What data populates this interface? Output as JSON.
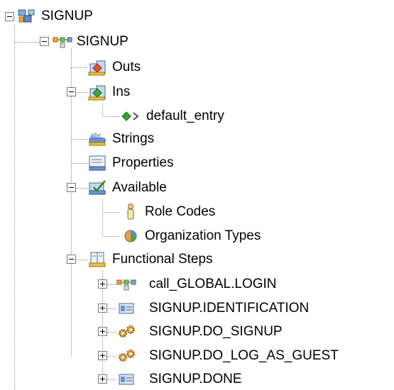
{
  "tree": {
    "root": {
      "label": "SIGNUP",
      "icon": "process-icon",
      "expanded": true
    },
    "process": {
      "label": "SIGNUP",
      "icon": "flow-icon",
      "expanded": true
    },
    "outs": {
      "label": "Outs",
      "icon": "outs-icon"
    },
    "ins": {
      "label": "Ins",
      "icon": "ins-icon",
      "expanded": true,
      "children": [
        {
          "label": "default_entry",
          "icon": "entry-icon"
        }
      ]
    },
    "strings": {
      "label": "Strings",
      "icon": "strings-icon"
    },
    "properties": {
      "label": "Properties",
      "icon": "properties-icon"
    },
    "available": {
      "label": "Available",
      "icon": "available-icon",
      "expanded": true,
      "children": [
        {
          "label": "Role Codes",
          "icon": "person-icon"
        },
        {
          "label": "Organization Types",
          "icon": "organization-icon"
        }
      ]
    },
    "functional_steps": {
      "label": "Functional Steps",
      "icon": "book-icon",
      "expanded": true,
      "children": [
        {
          "label": "call_GLOBAL.LOGIN",
          "icon": "flow-icon",
          "expanded": false
        },
        {
          "label": "SIGNUP.IDENTIFICATION",
          "icon": "form-icon",
          "expanded": false
        },
        {
          "label": "SIGNUP.DO_SIGNUP",
          "icon": "gears-icon",
          "expanded": false
        },
        {
          "label": "SIGNUP.DO_LOG_AS_GUEST",
          "icon": "gears-icon",
          "expanded": false
        },
        {
          "label": "SIGNUP.DONE",
          "icon": "form-icon",
          "expanded": false
        }
      ]
    }
  }
}
